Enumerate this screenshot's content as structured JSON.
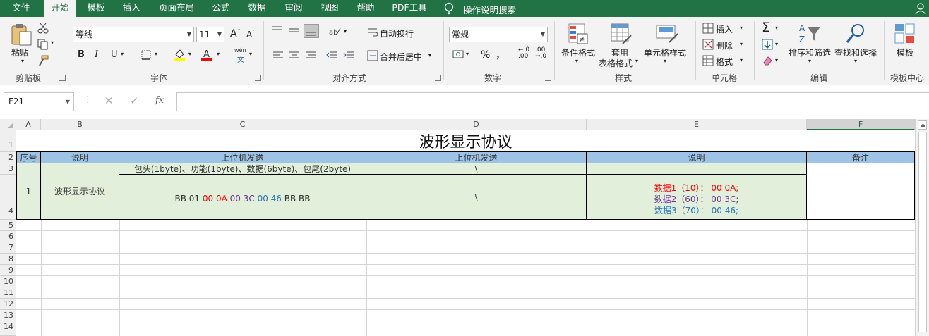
{
  "tabs": [
    "文件",
    "开始",
    "模板",
    "插入",
    "页面布局",
    "公式",
    "数据",
    "审阅",
    "视图",
    "帮助",
    "PDF工具"
  ],
  "active_tab": "开始",
  "tell_me": "操作说明搜索",
  "clipboard": {
    "paste": "粘贴",
    "label": "剪贴板"
  },
  "font": {
    "name": "等线",
    "size": "11",
    "bold": "B",
    "italic": "I",
    "underline": "U",
    "label": "字体",
    "phonetic": "wén"
  },
  "align": {
    "wrap": "自动换行",
    "merge": "合并后居中",
    "label": "对齐方式"
  },
  "number": {
    "format": "常规",
    "percent": "%",
    "comma": "，",
    "label": "数字"
  },
  "styles": {
    "cond": "条件格式",
    "table1": "套用",
    "table2": "表格格式",
    "cell": "单元格样式",
    "label": "样式"
  },
  "cells": {
    "insert": "插入",
    "delete": "删除",
    "format": "格式",
    "label": "单元格"
  },
  "editing": {
    "sort": "排序和筛选",
    "find": "查找和选择",
    "label": "编辑"
  },
  "template": {
    "btn": "模板",
    "label": "模板中心"
  },
  "formula_bar": {
    "name_box": "F21",
    "fx": "fx",
    "value": ""
  },
  "columns": [
    "A",
    "B",
    "C",
    "D",
    "E",
    "F"
  ],
  "rows": [
    "1",
    "2",
    "3",
    "4",
    "5",
    "6",
    "7",
    "8",
    "9",
    "10",
    "11",
    "12",
    "13",
    "14"
  ],
  "sheet": {
    "title": "波形显示协议",
    "headers": {
      "a": "序号",
      "b": "说明",
      "c": "上位机发送",
      "d": "上位机发送",
      "e": "说明",
      "f": "备注"
    },
    "r3": {
      "c": "包头(1byte)、功能(1byte)、数据(6byte)、包尾(2byte)",
      "d": "\\"
    },
    "r4": {
      "a": "1",
      "b": "波形显示协议",
      "c_parts": [
        "BB 01 ",
        "00 0A",
        " ",
        "00 3C",
        " ",
        "00 46",
        " BB BB"
      ],
      "d": "\\",
      "e1": "数据1（10）：  00 0A;",
      "e2": "数据2（60）：  00 3C;",
      "e3": "数据3（70）：  00 46;"
    }
  },
  "colors": {
    "brand": "#217346",
    "header_fill": "#9dc3e6",
    "green_fill": "#e2efda",
    "red": "#ff0000",
    "purple": "#7030a0",
    "blue": "#2e75b6"
  }
}
